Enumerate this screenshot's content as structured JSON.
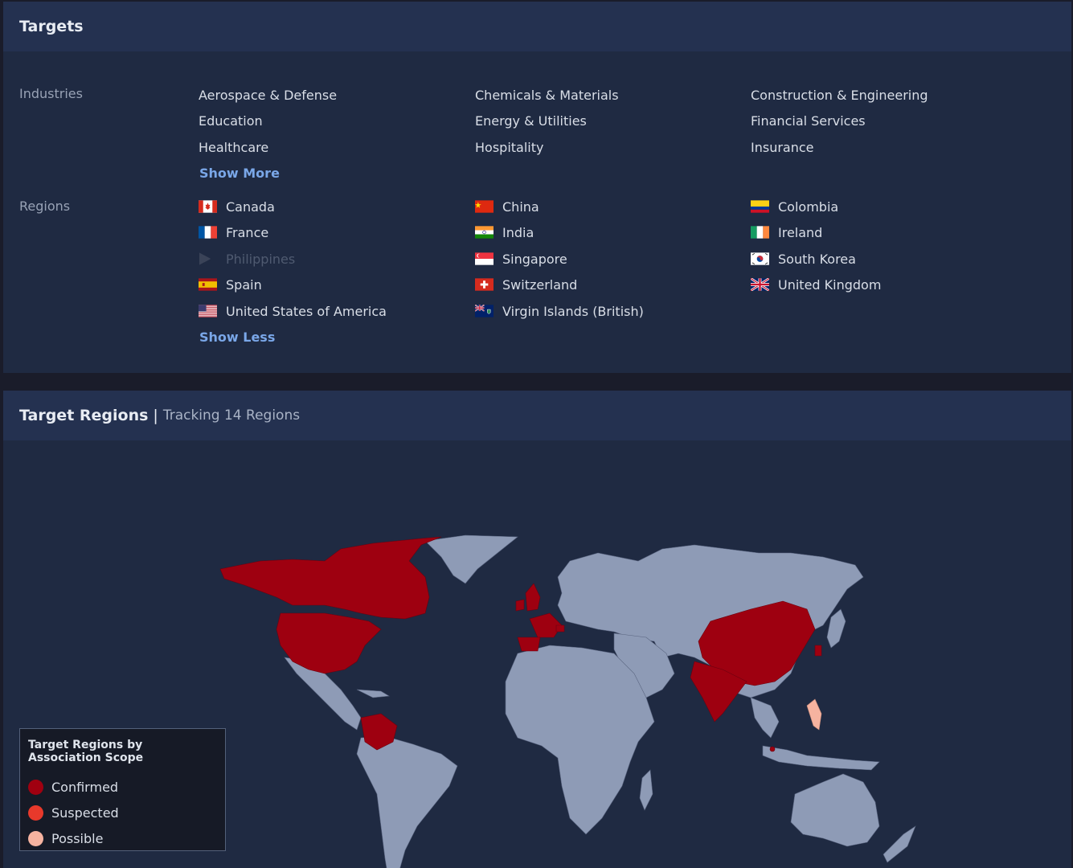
{
  "targets": {
    "title": "Targets",
    "industries_label": "Industries",
    "industries": [
      "Aerospace & Defense",
      "Chemicals & Materials",
      "Construction & Engineering",
      "Education",
      "Energy & Utilities",
      "Financial Services",
      "Healthcare",
      "Hospitality",
      "Insurance"
    ],
    "show_more_label": "Show More",
    "regions_label": "Regions",
    "regions": [
      {
        "name": "Canada",
        "flag": "canada-flag-icon"
      },
      {
        "name": "China",
        "flag": "china-flag-icon"
      },
      {
        "name": "Colombia",
        "flag": "colombia-flag-icon"
      },
      {
        "name": "France",
        "flag": "france-flag-icon"
      },
      {
        "name": "India",
        "flag": "india-flag-icon"
      },
      {
        "name": "Ireland",
        "flag": "ireland-flag-icon"
      },
      {
        "name": "Philippines",
        "flag": "play-icon",
        "disabled": true
      },
      {
        "name": "Singapore",
        "flag": "singapore-flag-icon"
      },
      {
        "name": "South Korea",
        "flag": "south-korea-flag-icon"
      },
      {
        "name": "Spain",
        "flag": "spain-flag-icon"
      },
      {
        "name": "Switzerland",
        "flag": "switzerland-flag-icon"
      },
      {
        "name": "United Kingdom",
        "flag": "uk-flag-icon"
      },
      {
        "name": "United States of America",
        "flag": "usa-flag-icon"
      },
      {
        "name": "Virgin Islands (British)",
        "flag": "bvi-flag-icon"
      }
    ],
    "show_less_label": "Show Less"
  },
  "target_regions": {
    "title": "Target Regions",
    "separator": "|",
    "subtitle": "Tracking 14 Regions"
  },
  "legend": {
    "title": "Target Regions by Association Scope",
    "items": [
      {
        "label": "Confirmed",
        "color": "#a00010"
      },
      {
        "label": "Suspected",
        "color": "#e8392b"
      },
      {
        "label": "Possible",
        "color": "#f6b3a0"
      }
    ]
  },
  "colors": {
    "land": "#8e9bb6",
    "confirmed": "#9e0010",
    "possible": "#f6b3a0",
    "link": "#7aa7e8"
  }
}
